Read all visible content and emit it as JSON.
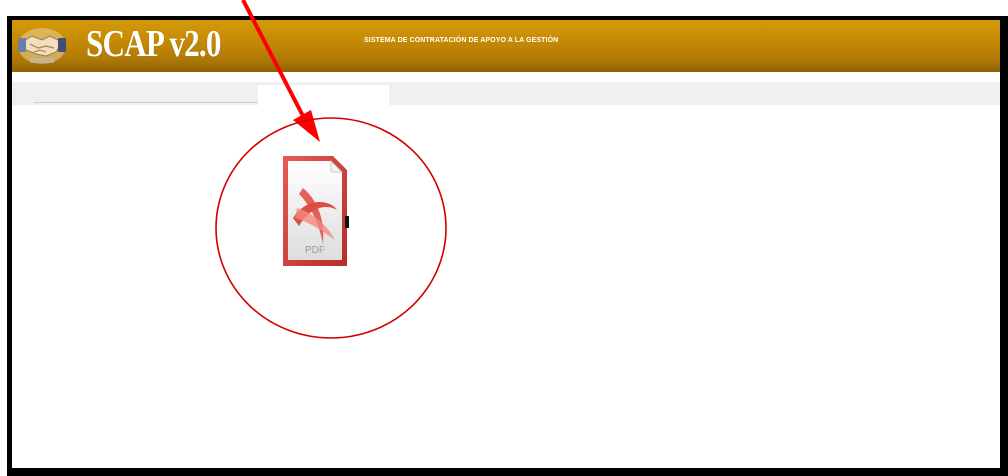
{
  "header": {
    "title": "SCAP v2.0",
    "subtitle": "SISTEMA DE CONTRATACIÓN DE APOYO A LA GESTIÓN",
    "logo_icon": "handshake-icon",
    "color": "#c98c05"
  },
  "tabs": {
    "active_tab_label": ""
  },
  "content": {
    "file_icon": "pdf-file-icon",
    "file_label": "PDF"
  },
  "annotation": {
    "arrow_color": "#ff0000",
    "circle_color": "#d40000"
  }
}
